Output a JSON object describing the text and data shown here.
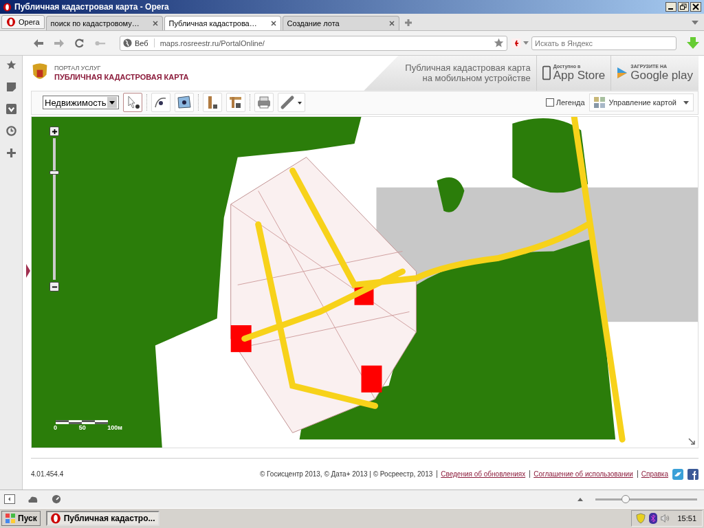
{
  "window": {
    "title": "Публичная кадастровая карта - Opera"
  },
  "menu_button": "Opera",
  "tabs": [
    {
      "label": "поиск по кадастровому…",
      "selected": false
    },
    {
      "label": "Публичная кадастрова…",
      "selected": true
    },
    {
      "label": "Создание лота",
      "selected": false
    }
  ],
  "address_bar": {
    "badge": "Веб",
    "url": "maps.rosreestr.ru/PortalOnline/"
  },
  "search": {
    "placeholder": "Искать в Яндекс"
  },
  "header": {
    "portal": "ПОРТАЛ УСЛУГ",
    "title": "ПУБЛИЧНАЯ КАДАСТРОВАЯ КАРТА",
    "mobile_text": [
      "Публичная кадастровая карта",
      "на мобильном устройстве"
    ],
    "app_store": {
      "small": "Доступно в",
      "big": "App Store"
    },
    "google_play": {
      "small": "ЗАГРУЗИТЕ НА",
      "big": "Google play"
    }
  },
  "toolbar": {
    "layer_select": "Недвижимость",
    "legend": {
      "label": "Легенда",
      "checked": false
    },
    "map_control": "Управление картой"
  },
  "map": {
    "kind": "picture",
    "zoom": {
      "level": 0.76
    },
    "scale_labels": [
      "0",
      "50",
      "100м"
    ]
  },
  "footer": {
    "version": "4.01.454.4",
    "copyright": "© Госисцентр 2013, © Дата+ 2013 | © Росреестр, 2013",
    "links": [
      "Сведения об обновлениях",
      "Соглашение об использовании",
      "Справка"
    ]
  },
  "status_bar": {
    "zoom": {
      "level": 0.3
    }
  },
  "taskbar": {
    "start": "Пуск",
    "task": "Публичная кадастро...",
    "clock": "15:51"
  }
}
